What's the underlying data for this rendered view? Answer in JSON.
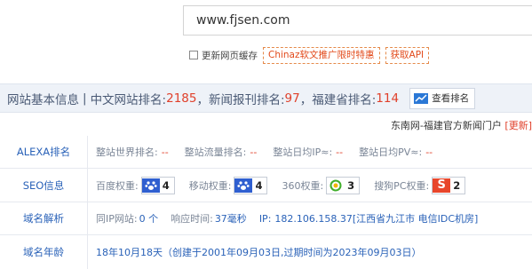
{
  "search": {
    "value": "www.fjsen.com"
  },
  "options": {
    "refresh_label": "更新网页缓存",
    "promo_label": "Chinaz软文推广限时特惠",
    "api_label": "获取API"
  },
  "info_bar": {
    "title": "网站基本信息",
    "cn_rank_label": "中文网站排名:",
    "cn_rank_value": "2185",
    "news_label": "，新闻报刊排名:",
    "news_value": "97",
    "fj_label": "，福建省排名:",
    "fj_value": "114",
    "view_rank_label": "查看排名"
  },
  "sub": {
    "text": "东南网-福建官方新闻门户",
    "update_label": "[更新]"
  },
  "alexa": {
    "label": "ALEXA排名",
    "world_label": "整站世界排名:",
    "world_value": "--",
    "traffic_label": "整站流量排名:",
    "traffic_value": "--",
    "ip_label": "整站日均IP≈:",
    "ip_value": "--",
    "pv_label": "整站日均PV≈:",
    "pv_value": "--"
  },
  "seo": {
    "label": "SEO信息",
    "baidu_label": "百度权重:",
    "baidu_value": "4",
    "mobile_label": "移动权重:",
    "mobile_value": "4",
    "s360_label": "360权重:",
    "s360_value": "3",
    "sogou_label": "搜狗PC权重:",
    "sogou_value": "2"
  },
  "domain": {
    "label": "域名解析",
    "same_ip_label": "同IP网站:",
    "same_ip_value": "0 个",
    "resp_label": "响应时间:",
    "resp_value": "37毫秒",
    "ip_label": "IP:",
    "ip_value": "182.106.158.37[江西省九江市 电信IDC机房]"
  },
  "age": {
    "label": "域名年龄",
    "value": "18年10月18天（创建于2001年09月03日,过期时间为2023年09月03日）"
  },
  "colors": {
    "accent_red": "#e0402b",
    "link_blue": "#2a62b8",
    "bar_bg": "#eef2f8"
  }
}
